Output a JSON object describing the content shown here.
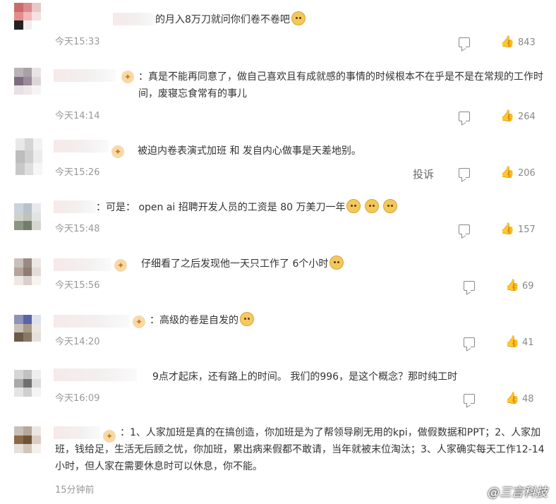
{
  "comments": [
    {
      "text": "的月入8万刀就问你们卷不卷吧",
      "time": "今天15:33",
      "likes": "843",
      "badge": false,
      "emoji": [
        "doge-emoji"
      ],
      "avatar_colors": [
        "#c96b6b",
        "#d98a8a",
        "#e8c8c8",
        "#e28c8c",
        "#f0b8b8",
        "#f4e0e0",
        "#222222",
        "#eeeeee",
        "#ffffff"
      ]
    },
    {
      "text": "：真是不能再同意了，做自己喜欢且有成就感的事情的时候根本不在乎是不是在常规的工作时间，废寝忘食常有的事儿",
      "time": "今天14:14",
      "likes": "264",
      "badge": true,
      "emoji": [],
      "avatar_colors": [
        "#b9b3b6",
        "#a8a1a6",
        "#e9e3e6",
        "#7d6c80",
        "#9b8a9a",
        "#dcd6da",
        "#e6e1e3",
        "#efe8e8",
        "#f7f4f4"
      ]
    },
    {
      "text": "被迫内卷表演式加班 和 发自内心做事是天差地别。",
      "time": "今天15:26",
      "likes": "206",
      "badge": true,
      "report": "投诉",
      "emoji": [],
      "avatar_colors": [
        "#e8e8e8",
        "#d5d5d5",
        "#f2f2f2",
        "#bdbdbd",
        "#cfcfcf",
        "#ececec",
        "#c8c8c8",
        "#dedede",
        "#f6f6f6"
      ]
    },
    {
      "text": "：可是： open ai 招聘开发人员的工资是 80 万美刀一年",
      "time": "今天15:48",
      "likes": "157",
      "badge": false,
      "emoji": [
        "doge-emoji",
        "doge-emoji",
        "doge-emoji"
      ],
      "avatar_colors": [
        "#c9d3dc",
        "#b8c2cc",
        "#e6eaee",
        "#cfd2cc",
        "#bfc3bb",
        "#e2e4e0",
        "#8b9682",
        "#737d6c",
        "#d4d8d0"
      ]
    },
    {
      "text": "仔细看了之后发现他一天只工作了 6个小时",
      "time": "今天15:56",
      "likes": "69",
      "badge": true,
      "emoji": [
        "doge-emoji"
      ],
      "avatar_colors": [
        "#c7c0bc",
        "#9a8a84",
        "#ede8e5",
        "#b5a49c",
        "#8f7c74",
        "#e3dcd8",
        "#ede8e6",
        "#d8d0cc",
        "#f7f3f1"
      ]
    },
    {
      "text": "：高级的卷是自发的",
      "time": "今天14:20",
      "likes": "41",
      "badge": true,
      "emoji": [
        "sad-emoji"
      ],
      "avatar_colors": [
        "#8c92b8",
        "#5a62a8",
        "#dfe1ee",
        "#c9bfb5",
        "#a8998a",
        "#ece6e0",
        "#6b5a4a",
        "#8a7866",
        "#e6e0da"
      ]
    },
    {
      "text": "9点才起床，还有路上的时间。 我们的996，是这个概念？那时纯工时",
      "time": "今天16:09",
      "likes": "48",
      "badge": true,
      "emoji": [],
      "avatar_colors": [
        "#d6d6d6",
        "#c2c2c2",
        "#efefef",
        "#a9a9a9",
        "#6f6f6f",
        "#dddddd",
        "#e4e4e4",
        "#cfcfcf",
        "#f4f4f4"
      ]
    },
    {
      "text": "：1、人家加班是真的在搞创造，你加班是为了帮领导刷无用的kpi，做假数据和PPT；2、人家加班，钱给足，生活无后顾之忧，你加班，累出病来假都不敢请，当年就被末位淘汰；3、人家确实每天工作12-14小时，但人家在需要休息时可以休息，你不能。",
      "time": "15分钟前",
      "badge": true,
      "emoji": [],
      "avatar_colors": [
        "#c8c0b8",
        "#b5a89a",
        "#ece7e2",
        "#8a6a48",
        "#6f5238",
        "#d9cec2",
        "#e6e0da",
        "#d0c6bc",
        "#f4f0ec"
      ]
    }
  ],
  "watermark": "@三言科技"
}
